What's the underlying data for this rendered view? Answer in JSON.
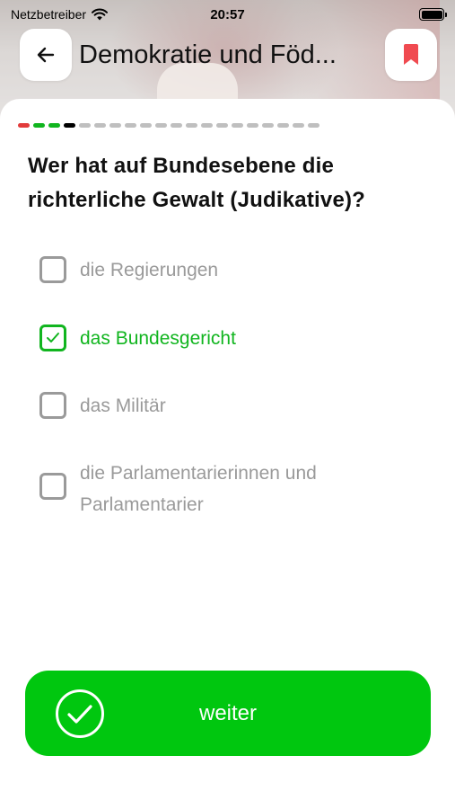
{
  "status_bar": {
    "carrier": "Netzbetreiber",
    "time": "20:57"
  },
  "header": {
    "title": "Demokratie und Föd..."
  },
  "progress": {
    "total_segments": 20,
    "segments": [
      {
        "state": "wrong",
        "color": "#e23b3b"
      },
      {
        "state": "correct",
        "color": "#11b51f"
      },
      {
        "state": "correct",
        "color": "#11b51f"
      },
      {
        "state": "current",
        "color": "#000000"
      }
    ],
    "pending_color": "#bfbfbf"
  },
  "question": {
    "text": "Wer hat auf Bundesebene die richterliche Gewalt (Judikative)?"
  },
  "answers": [
    {
      "label": "die Regierungen",
      "selected": false
    },
    {
      "label": "das Bundesgericht",
      "selected": true
    },
    {
      "label": "das Militär",
      "selected": false
    },
    {
      "label": "die Parlamentarierinnen und Parlamentarier",
      "selected": false
    }
  ],
  "next_button": {
    "label": "weiter",
    "icon": "check-circle-icon"
  },
  "colors": {
    "accent": "#00c70f",
    "selected_text": "#11b51f",
    "bookmark": "#f04a50"
  }
}
